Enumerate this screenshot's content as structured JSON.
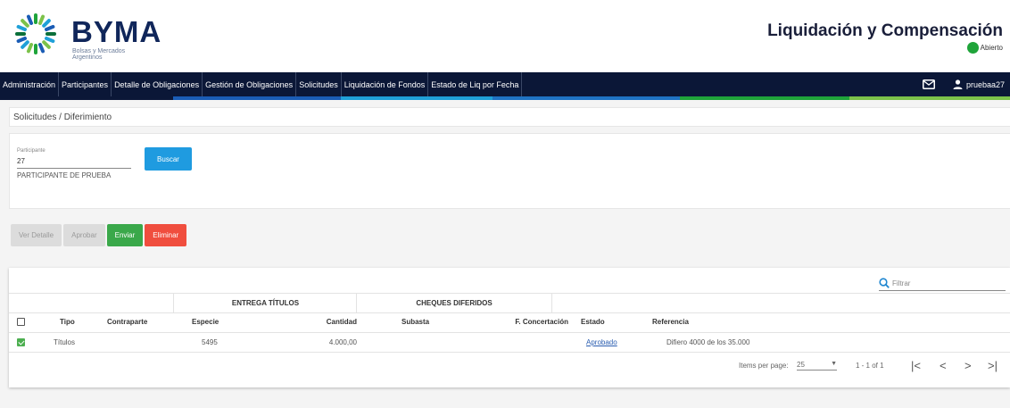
{
  "logo": {
    "name": "BYMA",
    "subtitle_line1": "Bolsas y Mercados",
    "subtitle_line2": "Argentinos"
  },
  "app_title": "Liquidación y Compensación",
  "status_text": "Abierto",
  "status_color": "#1fa43a",
  "nav": {
    "items": [
      "Administración",
      "Participantes",
      "Detalle de Obligaciones",
      "Gestión de Obligaciones",
      "Solicitudes",
      "Liquidación de Fondos",
      "Estado de Liq por Fecha"
    ],
    "user": "pruebaa27"
  },
  "stripe_colors": [
    "#0b1737",
    "#1a5cb5",
    "#1fa0d8",
    "#1f73c4",
    "#1fa43a",
    "#7cc24a",
    "#0b1737"
  ],
  "breadcrumb": "Solicitudes / Diferimiento",
  "filter": {
    "label": "Participante",
    "value": "27",
    "description": "PARTICIPANTE DE PRUEBA",
    "search_button": "Buscar"
  },
  "actions": {
    "ver_detalle": "Ver Detalle",
    "aprobar": "Aprobar",
    "enviar": "Enviar",
    "eliminar": "Eliminar"
  },
  "table": {
    "filter_placeholder": "Filtrar",
    "groups": {
      "entrega": "ENTREGA TÍTULOS",
      "cheques": "CHEQUES DIFERIDOS"
    },
    "columns": {
      "tipo": "Tipo",
      "contraparte": "Contraparte",
      "especie": "Especie",
      "cantidad": "Cantidad",
      "subasta": "Subasta",
      "concertacion": "F. Concertación",
      "estado": "Estado",
      "referencia": "Referencia"
    },
    "rows": [
      {
        "checked": true,
        "tipo": "Títulos",
        "contraparte": "",
        "especie": "5495",
        "cantidad": "4.000,00",
        "subasta": "",
        "concertacion": "",
        "estado": "Aprobado",
        "referencia": "Difiero 4000 de los 35.000"
      }
    ]
  },
  "pager": {
    "items_label": "Items per page:",
    "page_size": "25",
    "range": "1 - 1 of 1"
  }
}
